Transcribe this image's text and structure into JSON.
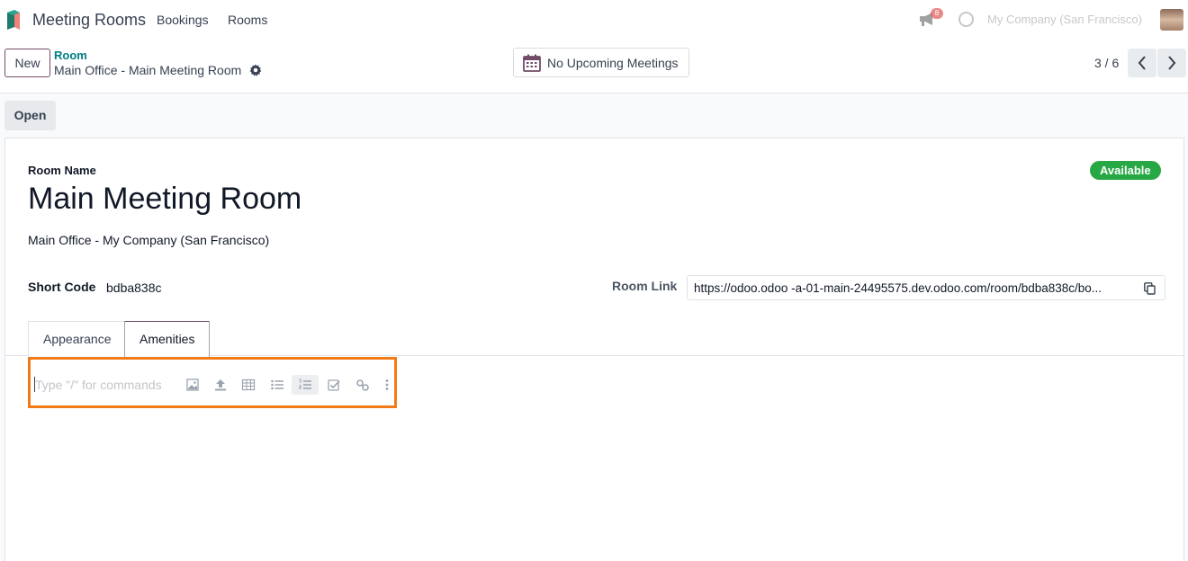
{
  "navbar": {
    "app_title": "Meeting Rooms",
    "menu": [
      "Bookings",
      "Rooms"
    ],
    "notification_count": "8",
    "company": "My Company (San Francisco)"
  },
  "control_panel": {
    "new_label": "New",
    "breadcrumb_parent": "Room",
    "breadcrumb_current": "Main Office - Main Meeting Room",
    "meetings_button": "No Upcoming Meetings",
    "pager": "3 / 6"
  },
  "status_bar": {
    "open_label": "Open"
  },
  "form": {
    "room_name_label": "Room Name",
    "room_name": "Main Meeting Room",
    "location": "Main Office - My Company (San Francisco)",
    "status": "Available",
    "short_code_label": "Short Code",
    "short_code": "bdba838c",
    "room_link_label": "Room Link",
    "room_link": "https://odoo.odoo -a-01-main-24495575.dev.odoo.com/room/bdba838c/bo..."
  },
  "tabs": [
    {
      "label": "Appearance"
    },
    {
      "label": "Amenities"
    }
  ],
  "editor": {
    "placeholder": "Type \"/\" for commands",
    "toolbar": [
      "image-icon",
      "upload-icon",
      "table-icon",
      "bullet-list-icon",
      "numbered-list-icon",
      "checklist-icon",
      "link-icon",
      "more-icon"
    ]
  },
  "colors": {
    "brand": "#714b67",
    "link": "#017e84",
    "status": "#28a745",
    "highlight": "#f27a19"
  }
}
